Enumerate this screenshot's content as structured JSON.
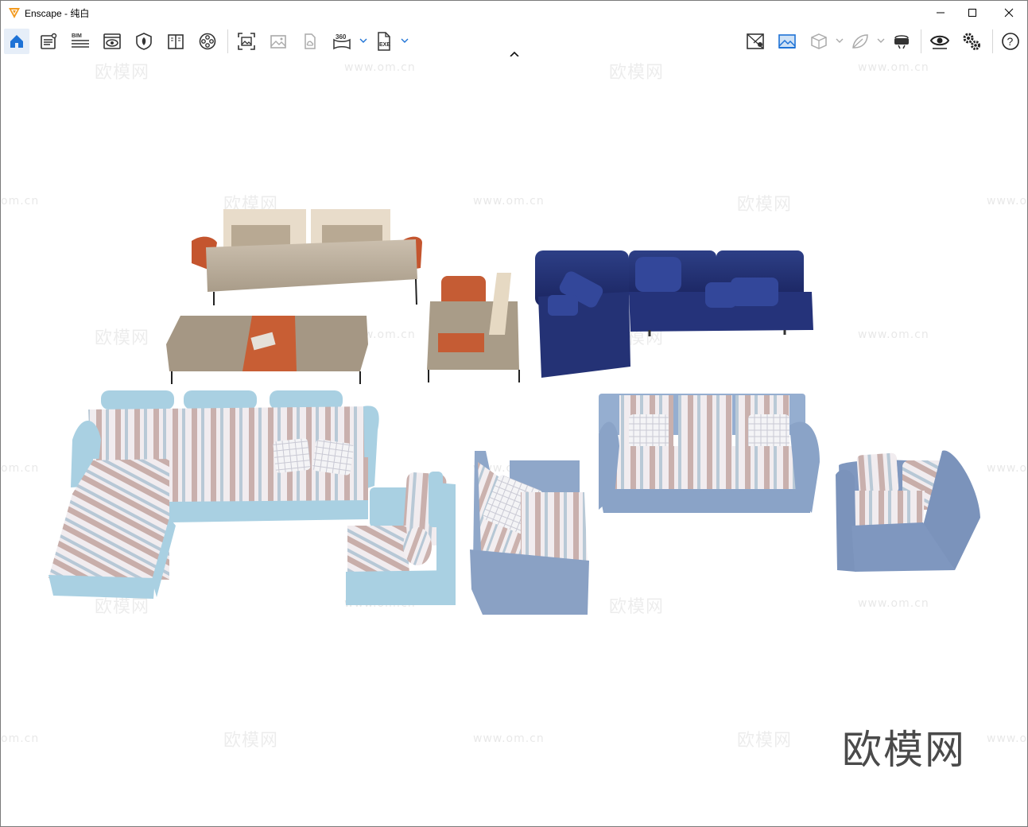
{
  "window": {
    "title": "Enscape - 纯白",
    "controls": [
      "minimize",
      "maximize",
      "close"
    ]
  },
  "toolbar": {
    "left_tools": [
      {
        "name": "home",
        "icon": "home-icon",
        "active": true
      },
      {
        "name": "project-info",
        "icon": "document-list-icon"
      },
      {
        "name": "bim",
        "icon": "bim-icon",
        "text": "BIM"
      },
      {
        "name": "views",
        "icon": "eye-monitor-icon"
      },
      {
        "name": "asset-library",
        "icon": "leaf-shield-icon"
      },
      {
        "name": "material-editor",
        "icon": "book-icon"
      },
      {
        "name": "video-editor",
        "icon": "film-reel-icon"
      },
      {
        "name": "screenshot",
        "icon": "image-frame-icon"
      },
      {
        "name": "batch-render",
        "icon": "image-stack-icon"
      },
      {
        "name": "upload",
        "icon": "cloud-document-icon"
      },
      {
        "name": "panorama",
        "icon": "panorama-360-icon",
        "text": "360"
      },
      {
        "name": "export-exe",
        "icon": "exe-file-icon",
        "text": "EXE"
      }
    ],
    "right_tools": [
      {
        "name": "map",
        "icon": "map-marker-icon"
      },
      {
        "name": "visual-settings",
        "icon": "landscape-image-icon",
        "active": true
      },
      {
        "name": "cube",
        "icon": "cube-icon"
      },
      {
        "name": "leaf",
        "icon": "leaf-icon"
      },
      {
        "name": "vr-headset",
        "icon": "vr-headset-icon"
      },
      {
        "name": "visibility",
        "icon": "eye-icon"
      },
      {
        "name": "settings",
        "icon": "gears-icon"
      },
      {
        "name": "help",
        "icon": "help-icon",
        "text": "?"
      }
    ],
    "accent": "#1f73d6"
  },
  "watermarks": {
    "brand": "欧模网",
    "url": "www.om.cn",
    "url_partial": "om.cn",
    "brand_bottom": "欧模网"
  }
}
